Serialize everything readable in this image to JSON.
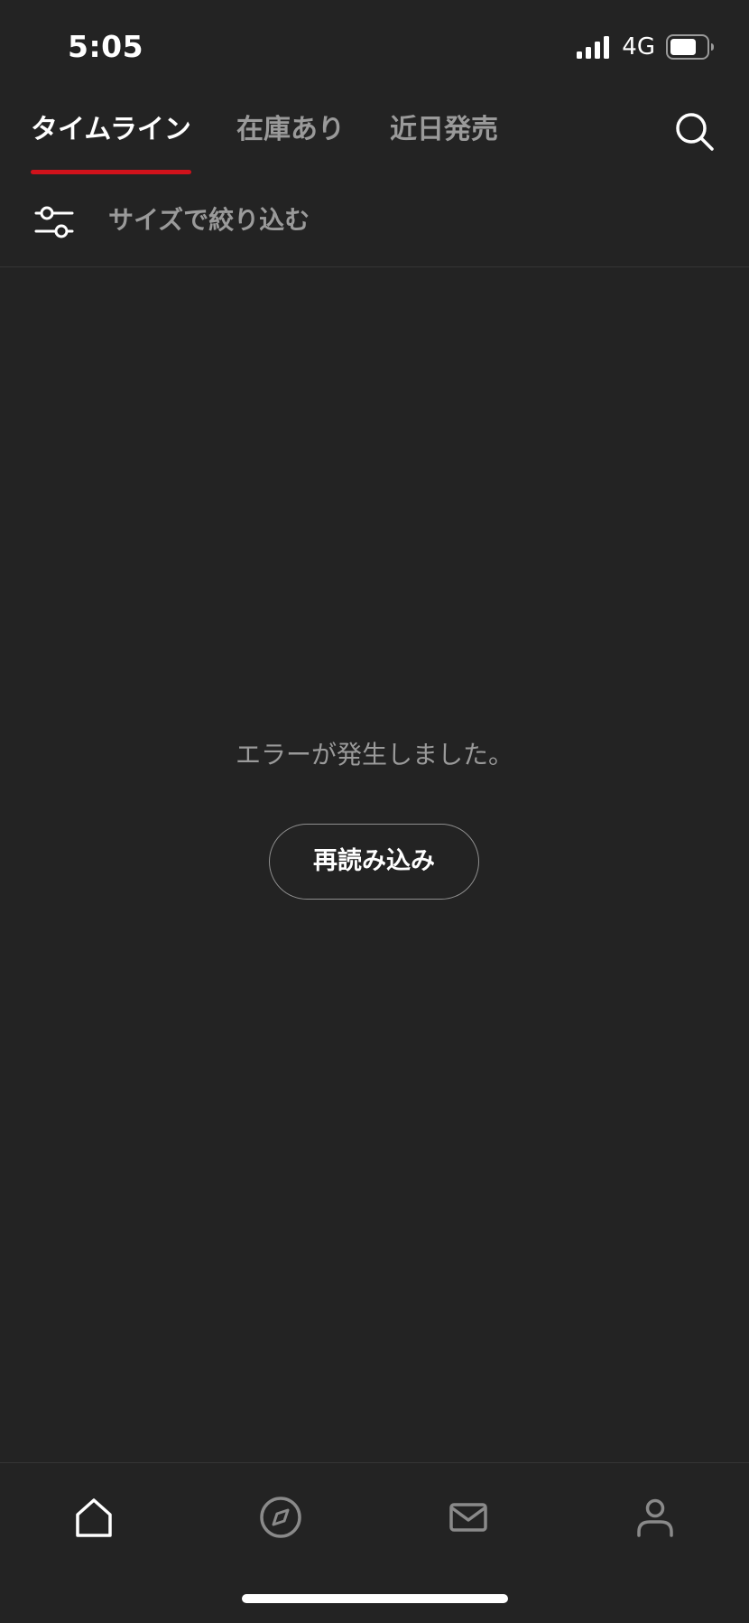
{
  "status_bar": {
    "time": "5:05",
    "network": "4G",
    "signal_icon": "signal-bars-icon",
    "battery_icon": "battery-icon"
  },
  "tabs": [
    {
      "label": "タイムライン",
      "active": true
    },
    {
      "label": "在庫あり",
      "active": false
    },
    {
      "label": "近日発売",
      "active": false
    }
  ],
  "search_icon": "search-icon",
  "filter": {
    "icon": "sliders-icon",
    "label": "サイズで絞り込む"
  },
  "content": {
    "error_message": "エラーが発生しました。",
    "reload_label": "再読み込み"
  },
  "bottom_nav": [
    {
      "icon": "home-icon",
      "active": true
    },
    {
      "icon": "compass-icon",
      "active": false
    },
    {
      "icon": "mail-icon",
      "active": false
    },
    {
      "icon": "user-icon",
      "active": false
    }
  ],
  "colors": {
    "background": "#232323",
    "accent": "#d0121b",
    "inactive_text": "#9a9a9a",
    "active_text": "#ffffff"
  }
}
